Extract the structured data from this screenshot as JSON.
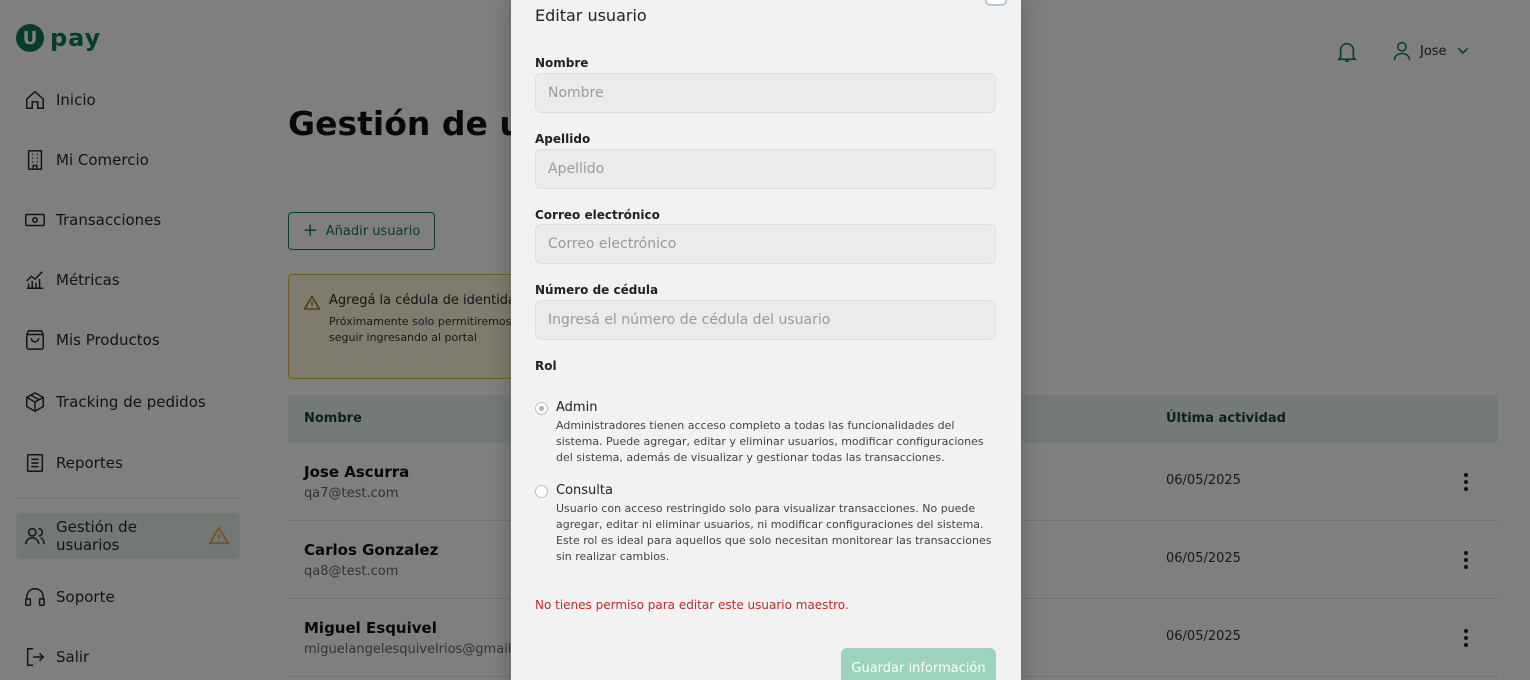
{
  "brand": {
    "logo_letter": "U",
    "logo_text": "pay"
  },
  "sidebar": {
    "items": [
      {
        "label": "Inicio",
        "icon": "home-icon"
      },
      {
        "label": "Mi Comercio",
        "icon": "building-icon"
      },
      {
        "label": "Transacciones",
        "icon": "cash-icon"
      },
      {
        "label": "Métricas",
        "icon": "metrics-icon"
      },
      {
        "label": "Mis Productos",
        "icon": "bag-icon"
      },
      {
        "label": "Tracking de pedidos",
        "icon": "package-icon"
      },
      {
        "label": "Reportes",
        "icon": "report-icon"
      },
      {
        "label": "Gestión de usuarios",
        "icon": "users-icon"
      },
      {
        "label": "Soporte",
        "icon": "headset-icon"
      },
      {
        "label": "Salir",
        "icon": "logout-icon"
      }
    ]
  },
  "header": {
    "user_name": "Jose"
  },
  "main": {
    "title": "Gestión de usuarios",
    "add_button": "Añadir usuario",
    "alert": {
      "title": "Agregá la cédula de identidad",
      "body": "Próximamente solo permitiremos a bank y necesitamos que agregues l puedan seguir ingresando al portal"
    },
    "table": {
      "headers": {
        "name": "Nombre",
        "last_activity": "Última actividad"
      },
      "rows": [
        {
          "name": "Jose Ascurra",
          "email": "qa7@test.com",
          "last": "06/05/2025"
        },
        {
          "name": "Carlos Gonzalez",
          "email": "qa8@test.com",
          "last": "06/05/2025"
        },
        {
          "name": "Miguel Esquivel",
          "email": "miguelangelesquivelrios@gmail.c",
          "last": "06/05/2025"
        }
      ]
    }
  },
  "modal": {
    "title": "Editar usuario",
    "fields": {
      "nombre": {
        "label": "Nombre",
        "placeholder": "Nombre"
      },
      "apellido": {
        "label": "Apellido",
        "placeholder": "Apellido"
      },
      "correo": {
        "label": "Correo electrónico",
        "placeholder": "Correo electrónico"
      },
      "cedula": {
        "label": "Número de cédula",
        "placeholder": "Ingresá el número de cédula del usuario"
      }
    },
    "rol_label": "Rol",
    "roles": [
      {
        "title": "Admin",
        "checked": true,
        "desc": "Administradores tienen acceso completo a todas las funcionalidades del sistema. Puede agregar, editar y eliminar usuarios, modificar configuraciones del sistema, además de visualizar y gestionar todas las transacciones."
      },
      {
        "title": "Consulta",
        "checked": false,
        "desc": "Usuario con acceso restringido solo para visualizar transacciones. No puede agregar, editar ni eliminar usuarios, ni modificar configuraciones del sistema. Este rol es ideal para aquellos que solo necesitan monitorear las transacciones sin realizar cambios."
      }
    ],
    "error": "No tienes permiso para editar este usuario maestro.",
    "save_button": "Guardar información"
  },
  "colors": {
    "brand": "#0d7a4f",
    "error": "#c62828",
    "warning": "#e8a23a",
    "save_disabled": "#9bd3bd"
  }
}
